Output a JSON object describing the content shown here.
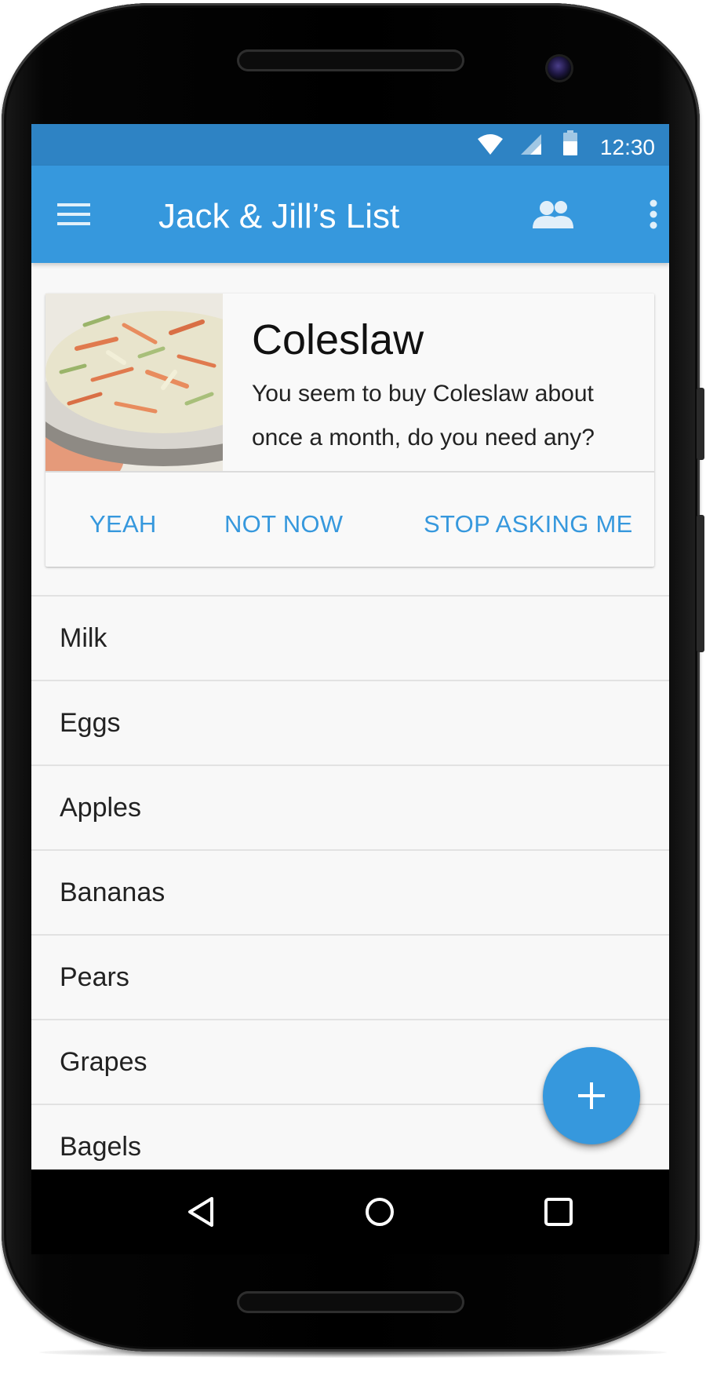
{
  "status_bar": {
    "time": "12:30",
    "icons": [
      "wifi-icon",
      "cell-signal-icon",
      "battery-icon"
    ]
  },
  "app_bar": {
    "title": "Jack & Jill’s List",
    "icons": [
      "menu-icon",
      "people-icon",
      "overflow-menu-icon"
    ],
    "color": "#3698dd",
    "status_color": "#2e83c4"
  },
  "suggestion_card": {
    "title": "Coleslaw",
    "body": "You seem to buy Coleslaw about once a month, do you need any?",
    "actions": {
      "yeah": "YEAH",
      "not_now": "NOT NOW",
      "stop": "STOP ASKING ME"
    },
    "image": "coleslaw-photo"
  },
  "list": {
    "items": [
      "Milk",
      "Eggs",
      "Apples",
      "Bananas",
      "Pears",
      "Grapes",
      "Bagels"
    ]
  },
  "fab": {
    "icon": "plus-icon"
  },
  "nav_bar": {
    "icons": [
      "back-icon",
      "home-icon",
      "recents-icon"
    ]
  }
}
